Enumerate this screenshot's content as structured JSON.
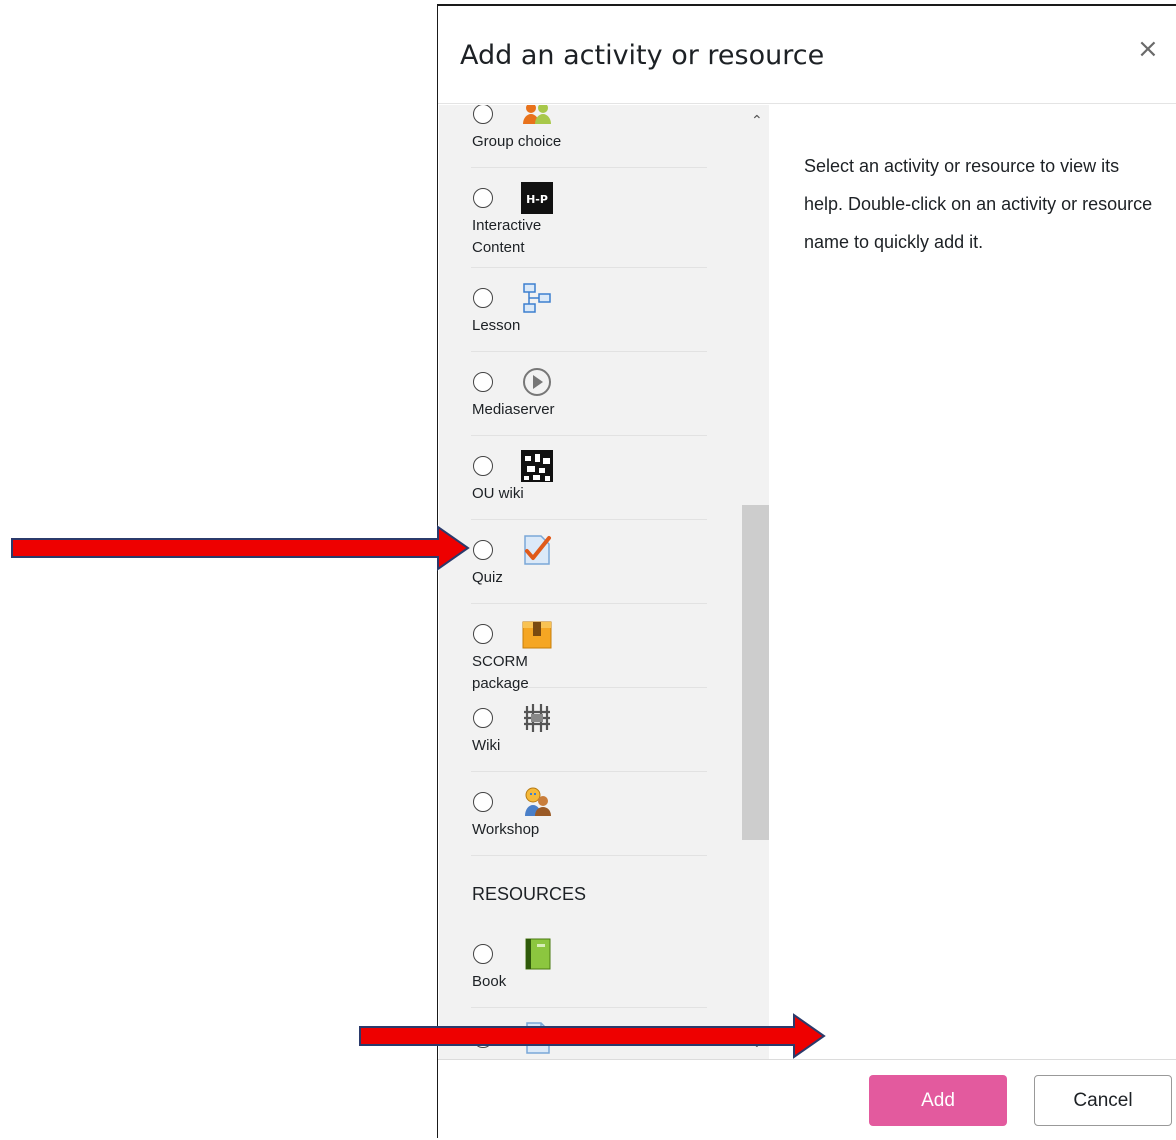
{
  "dialog": {
    "title": "Add an activity or resource",
    "close_symbol": "×"
  },
  "options": [
    {
      "label": "Group choice",
      "icon": "group-choice-icon"
    },
    {
      "label": "Interactive Content",
      "icon": "h5p-icon"
    },
    {
      "label": "Lesson",
      "icon": "lesson-icon"
    },
    {
      "label": "Mediaserver",
      "icon": "mediaserver-icon"
    },
    {
      "label": "OU wiki",
      "icon": "ou-wiki-icon"
    },
    {
      "label": "Quiz",
      "icon": "quiz-icon"
    },
    {
      "label": "SCORM package",
      "icon": "scorm-icon"
    },
    {
      "label": "Wiki",
      "icon": "wiki-icon"
    },
    {
      "label": "Workshop",
      "icon": "workshop-icon"
    }
  ],
  "resources": {
    "heading": "RESOURCES",
    "items": [
      {
        "label": "Book",
        "icon": "book-icon"
      },
      {
        "label": "",
        "icon": "file-icon"
      }
    ]
  },
  "help": {
    "text": "Select an activity or resource to view its help. Double-click on an activity or resource name to quickly add it."
  },
  "footer": {
    "add_label": "Add",
    "cancel_label": "Cancel"
  },
  "colors": {
    "add_button": "#e35a9e",
    "arrow": "#ee0000",
    "list_background": "#f2f2f2"
  }
}
